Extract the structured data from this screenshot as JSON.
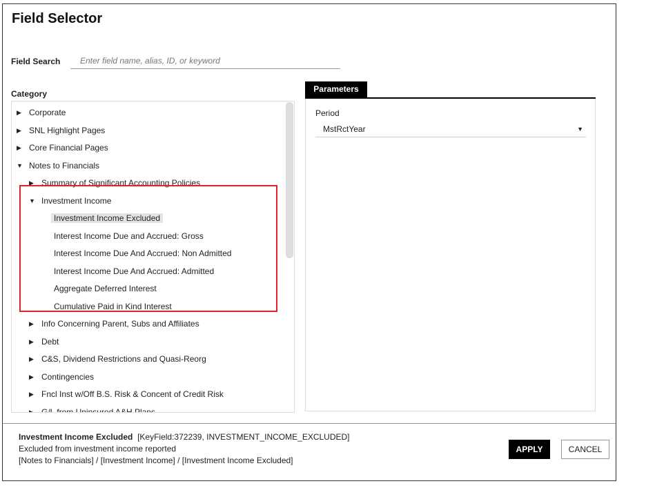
{
  "title": "Field Selector",
  "search": {
    "label": "Field Search",
    "placeholder": "Enter field name, alias, ID, or keyword",
    "value": ""
  },
  "category": {
    "label": "Category",
    "items": [
      {
        "label": "Corporate",
        "state": "collapsed",
        "level": 0
      },
      {
        "label": "SNL Highlight Pages",
        "state": "collapsed",
        "level": 0
      },
      {
        "label": "Core Financial Pages",
        "state": "collapsed",
        "level": 0
      },
      {
        "label": "Notes to Financials",
        "state": "expanded",
        "level": 0
      },
      {
        "label": "Summary of Significant Accounting Policies",
        "state": "collapsed",
        "level": 1
      },
      {
        "label": "Investment Income",
        "state": "expanded",
        "level": 1
      },
      {
        "label": "Investment Income Excluded",
        "state": "selected",
        "level": 2
      },
      {
        "label": "Interest Income Due and Accrued: Gross",
        "state": "leaf",
        "level": 2
      },
      {
        "label": "Interest Income Due And Accrued: Non Admitted",
        "state": "leaf",
        "level": 2
      },
      {
        "label": "Interest Income Due And Accrued: Admitted",
        "state": "leaf",
        "level": 2
      },
      {
        "label": "Aggregate Deferred Interest",
        "state": "leaf",
        "level": 2
      },
      {
        "label": "Cumulative Paid in Kind Interest",
        "state": "leaf",
        "level": 2
      },
      {
        "label": "Info Concerning Parent, Subs and Affiliates",
        "state": "collapsed",
        "level": 1
      },
      {
        "label": "Debt",
        "state": "collapsed",
        "level": 1
      },
      {
        "label": "C&S, Dividend Restrictions and Quasi-Reorg",
        "state": "collapsed",
        "level": 1
      },
      {
        "label": "Contingencies",
        "state": "collapsed",
        "level": 1
      },
      {
        "label": "Fncl Inst w/Off B.S. Risk & Concent of Credit Risk",
        "state": "collapsed",
        "level": 1
      },
      {
        "label": "G/L from Uninsured A&H Plans",
        "state": "collapsed",
        "level": 1
      }
    ]
  },
  "parameters": {
    "tab": "Parameters",
    "period_label": "Period",
    "period_value": "MstRctYear"
  },
  "footer": {
    "field_name": "Investment Income Excluded",
    "field_key": "[KeyField:372239, INVESTMENT_INCOME_EXCLUDED]",
    "description": "Excluded from investment income reported",
    "path": "[Notes to Financials] / [Investment Income] / [Investment Income Excluded]",
    "apply": "APPLY",
    "cancel": "CANCEL"
  },
  "colors": {
    "highlight_box": "#e0202a",
    "accent": "#000000"
  }
}
